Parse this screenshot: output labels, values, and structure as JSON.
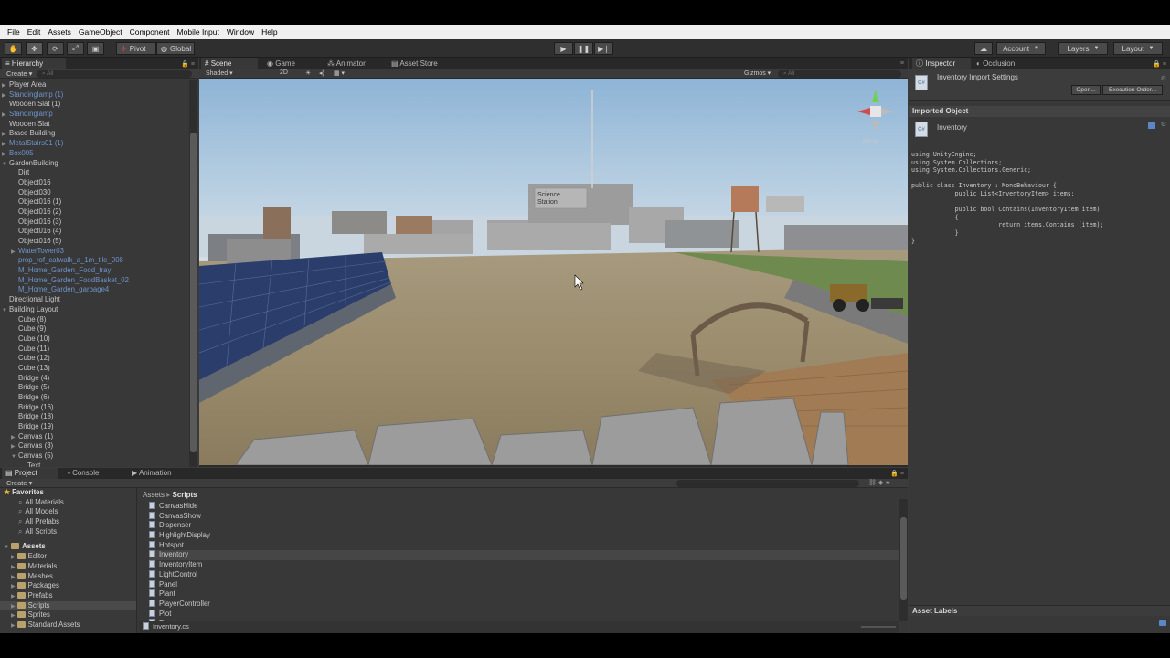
{
  "menu": [
    "File",
    "Edit",
    "Assets",
    "GameObject",
    "Component",
    "Mobile Input",
    "Window",
    "Help"
  ],
  "toolbar": {
    "pivot_label": "Pivot",
    "global_label": "Global",
    "account_label": "Account",
    "layers_label": "Layers",
    "layout_label": "Layout"
  },
  "hierarchy": {
    "tab_label": "Hierarchy",
    "create_label": "Create",
    "search_placeholder": "All",
    "items": [
      {
        "label": "Player Area",
        "indent": 0,
        "arrow": true,
        "blue": false
      },
      {
        "label": "Standinglamp (1)",
        "indent": 0,
        "arrow": true,
        "blue": true
      },
      {
        "label": "Wooden Slat (1)",
        "indent": 0,
        "arrow": false,
        "blue": false
      },
      {
        "label": "Standinglamp",
        "indent": 0,
        "arrow": true,
        "blue": true
      },
      {
        "label": "Wooden Slat",
        "indent": 0,
        "arrow": false,
        "blue": false
      },
      {
        "label": "Brace Building",
        "indent": 0,
        "arrow": true,
        "blue": false
      },
      {
        "label": "MetalStairs01 (1)",
        "indent": 0,
        "arrow": true,
        "blue": true
      },
      {
        "label": "Box005",
        "indent": 0,
        "arrow": true,
        "blue": true
      },
      {
        "label": "GardenBuilding",
        "indent": 0,
        "arrow": true,
        "open": true,
        "blue": false
      },
      {
        "label": "Dirt",
        "indent": 1,
        "arrow": false,
        "blue": false
      },
      {
        "label": "Object016",
        "indent": 1,
        "arrow": false,
        "blue": false
      },
      {
        "label": "Object030",
        "indent": 1,
        "arrow": false,
        "blue": false
      },
      {
        "label": "Object016 (1)",
        "indent": 1,
        "arrow": false,
        "blue": false
      },
      {
        "label": "Object016 (2)",
        "indent": 1,
        "arrow": false,
        "blue": false
      },
      {
        "label": "Object016 (3)",
        "indent": 1,
        "arrow": false,
        "blue": false
      },
      {
        "label": "Object016 (4)",
        "indent": 1,
        "arrow": false,
        "blue": false
      },
      {
        "label": "Object016 (5)",
        "indent": 1,
        "arrow": false,
        "blue": false
      },
      {
        "label": "WaterTower03",
        "indent": 1,
        "arrow": true,
        "blue": true
      },
      {
        "label": "prop_rof_catwalk_a_1m_tile_008",
        "indent": 1,
        "arrow": false,
        "blue": true
      },
      {
        "label": "M_Home_Garden_Food_tray",
        "indent": 1,
        "arrow": false,
        "blue": true
      },
      {
        "label": "M_Home_Garden_FoodBasket_02",
        "indent": 1,
        "arrow": false,
        "blue": true
      },
      {
        "label": "M_Home_Garden_garbage4",
        "indent": 1,
        "arrow": false,
        "blue": true
      },
      {
        "label": "Directional Light",
        "indent": 0,
        "arrow": false,
        "blue": false
      },
      {
        "label": "Building Layout",
        "indent": 0,
        "arrow": true,
        "open": true,
        "blue": false
      },
      {
        "label": "Cube (8)",
        "indent": 1,
        "arrow": false,
        "blue": false
      },
      {
        "label": "Cube (9)",
        "indent": 1,
        "arrow": false,
        "blue": false
      },
      {
        "label": "Cube (10)",
        "indent": 1,
        "arrow": false,
        "blue": false
      },
      {
        "label": "Cube (11)",
        "indent": 1,
        "arrow": false,
        "blue": false
      },
      {
        "label": "Cube (12)",
        "indent": 1,
        "arrow": false,
        "blue": false
      },
      {
        "label": "Cube (13)",
        "indent": 1,
        "arrow": false,
        "blue": false
      },
      {
        "label": "Bridge (4)",
        "indent": 1,
        "arrow": false,
        "blue": false
      },
      {
        "label": "Bridge (5)",
        "indent": 1,
        "arrow": false,
        "blue": false
      },
      {
        "label": "Bridge (6)",
        "indent": 1,
        "arrow": false,
        "blue": false
      },
      {
        "label": "Bridge (16)",
        "indent": 1,
        "arrow": false,
        "blue": false
      },
      {
        "label": "Bridge (18)",
        "indent": 1,
        "arrow": false,
        "blue": false
      },
      {
        "label": "Bridge (19)",
        "indent": 1,
        "arrow": false,
        "blue": false
      },
      {
        "label": "Canvas (1)",
        "indent": 1,
        "arrow": true,
        "blue": false
      },
      {
        "label": "Canvas (3)",
        "indent": 1,
        "arrow": true,
        "blue": false
      },
      {
        "label": "Canvas (5)",
        "indent": 1,
        "arrow": true,
        "open": true,
        "blue": false
      },
      {
        "label": "Text",
        "indent": 2,
        "arrow": false,
        "blue": false
      }
    ]
  },
  "scene": {
    "tabs": [
      "Scene",
      "Game",
      "Animator",
      "Asset Store"
    ],
    "shading_label": "Shaded",
    "mode_2d_label": "2D",
    "gizmos_label": "Gizmos",
    "search_placeholder": "All",
    "persp_label": "Persp",
    "sign_text": "Science Station"
  },
  "inspector": {
    "tabs": [
      "Inspector",
      "Occlusion"
    ],
    "title": "Inventory Import Settings",
    "open_button": "Open...",
    "execution_order_button": "Execution Order...",
    "imported_object_label": "Imported Object",
    "object_name": "Inventory",
    "code": "using UnityEngine;\nusing System.Collections;\nusing System.Collections.Generic;\n\npublic class Inventory : MonoBehaviour {\n            public List<InventoryItem> items;\n\n            public bool Contains(InventoryItem item)\n            {\n                        return items.Contains (item);\n            }\n}",
    "asset_labels": "Asset Labels"
  },
  "project": {
    "tabs": [
      "Project",
      "Console",
      "Animation"
    ],
    "create_label": "Create",
    "favorites_label": "Favorites",
    "favorites": [
      "All Materials",
      "All Models",
      "All Prefabs",
      "All Scripts"
    ],
    "assets_label": "Assets",
    "asset_folders": [
      "Editor",
      "Materials",
      "Meshes",
      "Packages",
      "Prefabs",
      "Scripts",
      "Sprites",
      "Standard Assets"
    ],
    "breadcrumb_root": "Assets",
    "breadcrumb_current": "Scripts",
    "files": [
      "CanvasHide",
      "CanvasShow",
      "Dispenser",
      "HighlightDisplay",
      "Hotspot",
      "Inventory",
      "InventoryItem",
      "LightControl",
      "Panel",
      "Plant",
      "PlayerController",
      "Plot",
      "Road"
    ],
    "selected_file": "Inventory.cs"
  }
}
